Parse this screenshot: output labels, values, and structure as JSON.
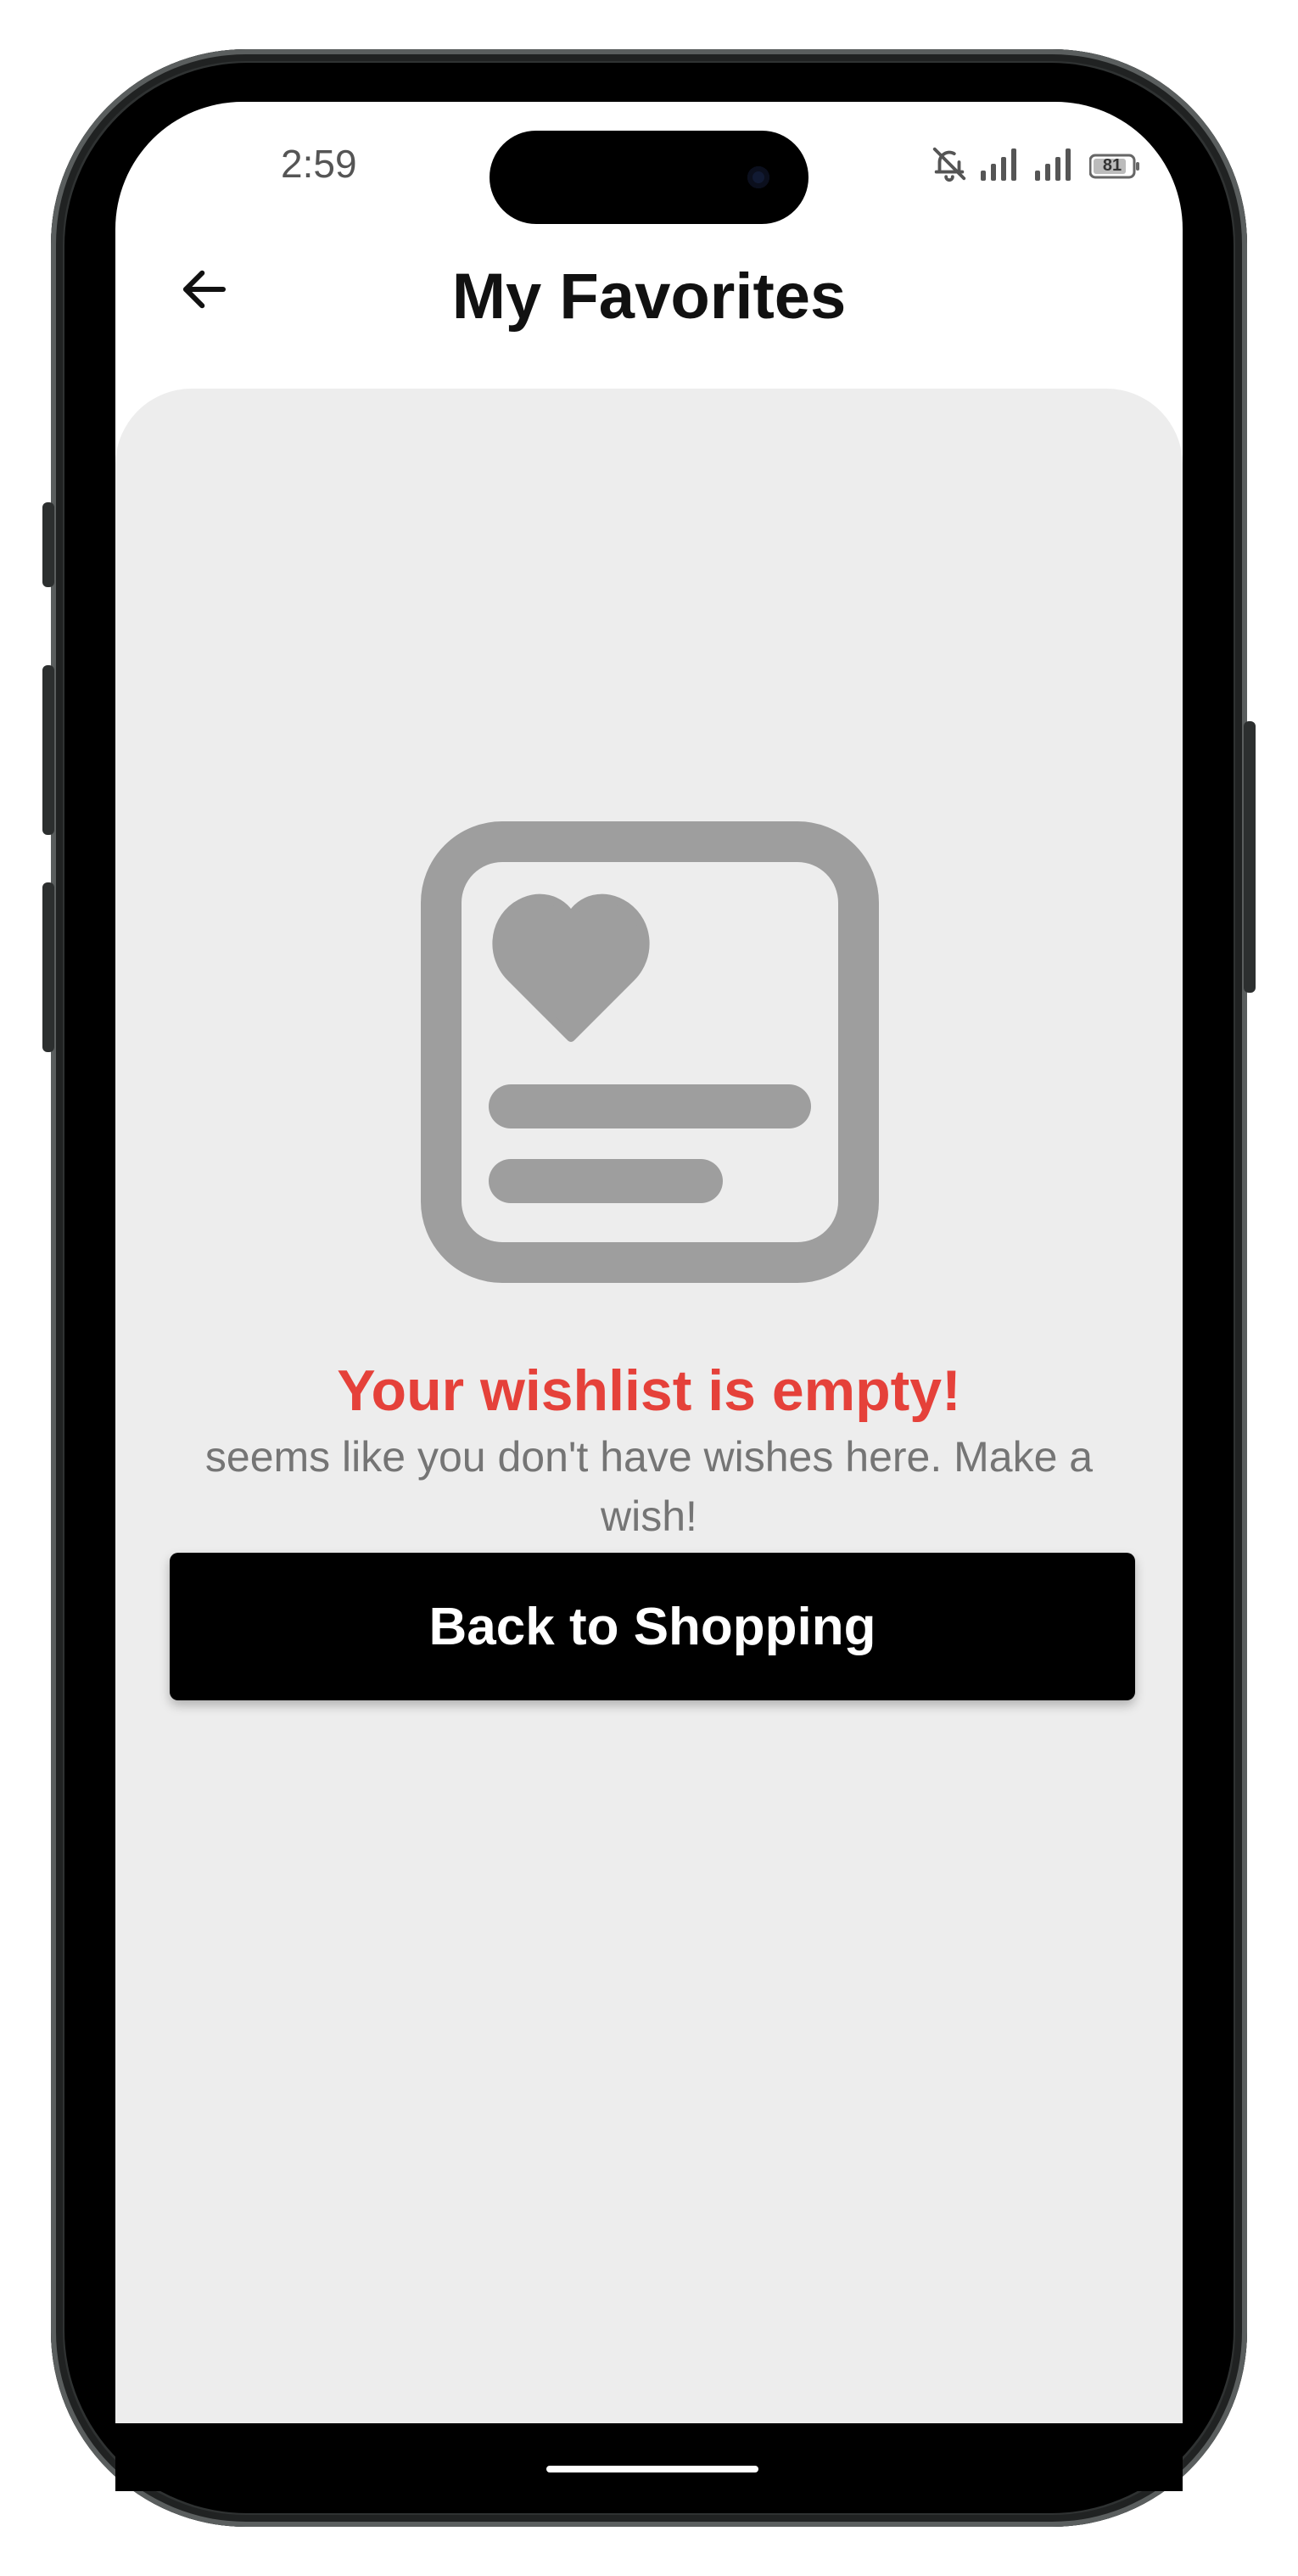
{
  "status_bar": {
    "time": "2:59",
    "battery": "81",
    "icons": [
      "bell-off-icon",
      "signal-icon",
      "signal-icon",
      "battery-icon"
    ]
  },
  "header": {
    "title": "My Favorites",
    "back_icon": "arrow-left-icon"
  },
  "empty_state": {
    "illustration_icon": "wishlist-card-heart-icon",
    "title": "Your wishlist is empty!",
    "subtitle": "seems like you don't have wishes here. Make a wish!",
    "button_label": "Back to Shopping"
  },
  "colors": {
    "accent_red": "#e5413a",
    "button_bg": "#000000",
    "content_bg": "#ededed",
    "illustration_gray": "#9e9e9e"
  }
}
